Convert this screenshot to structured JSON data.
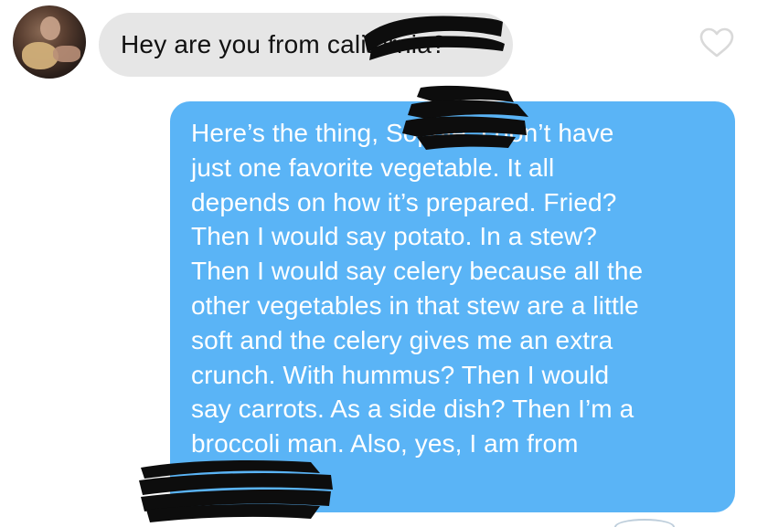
{
  "conversation": {
    "incoming": {
      "text": "Hey are you from california?"
    },
    "outgoing": {
      "text": "Here’s the thing, Sophie, I don’t have\njust one favorite vegetable. It all\ndepends on how it’s prepared. Fried?\nThen I would say potato. In a stew?\nThen I would say celery because all the\nother vegetables in that stew are a little\nsoft and the celery gives me an extra\ncrunch. With hummus? Then I would\nsay carrots. As a side dish? Then I’m a\nbroccoli man. Also, yes, I am from"
    },
    "icons": {
      "like": "heart-icon",
      "avatar": "avatar"
    }
  },
  "colors": {
    "incoming_bubble": "#e6e6e6",
    "outgoing_bubble": "#5ab4f6",
    "heart_outline": "#d9d9d9",
    "redaction": "#0d0d0d"
  }
}
